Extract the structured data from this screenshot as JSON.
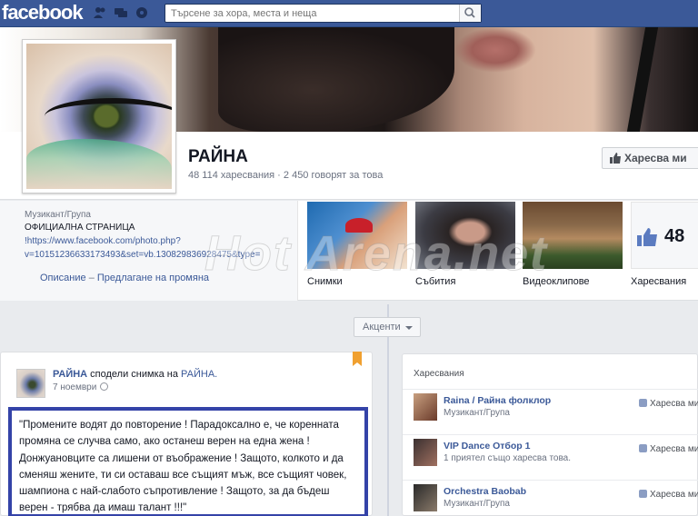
{
  "topbar": {
    "logo": "facebook",
    "search_placeholder": "Търсене за хора, места и неща",
    "icons": [
      "friend-requests-icon",
      "messages-icon",
      "notifications-icon",
      "search-icon"
    ]
  },
  "page": {
    "name": "РАЙНА",
    "stats": "48 114 харесвания · 2 450 говорят за това",
    "like_button": "Харесва ми"
  },
  "about": {
    "category": "Музикант/Група",
    "line1": "ОФИЦИАЛНА СТРАНИЦА",
    "line2": "!https://www.facebook.com/photo.php?",
    "line3": "v=10151236633173493&set=vb.130829836928475&type=",
    "link_description": "Описание",
    "link_suggest": "Предлагане на промяна"
  },
  "tiles": [
    {
      "label": "Снимки"
    },
    {
      "label": "Събития"
    },
    {
      "label": "Видеоклипове"
    },
    {
      "label": "Харесвания",
      "count": "48"
    }
  ],
  "timeline": {
    "accents_label": "Акценти"
  },
  "post": {
    "author": "РАЙНА",
    "action": " сподели снимка на ",
    "target": "РАЙНА.",
    "date": "7 ноември",
    "text": "\"Промените водят до повторение ! Парадоксално е, че коренната промяна се случва само, ако останеш верен на една жена ! Донжуановците са лишени от въображение ! Защото, колкото и да сменяш жените, ти си оставаш все същият мъж, все същият човек, шампиона с най-слабото съпротивление ! Защото, за да бъдеш верен - трябва да имаш талант !!!\""
  },
  "likes_box": {
    "title": "Харесвания",
    "items": [
      {
        "name": "Raina / Райна фолклор",
        "sub": "Музикант/Група",
        "action": "Харесва ми"
      },
      {
        "name": "VIP Dance Отбор 1",
        "sub": "1 приятел също харесва това.",
        "action": "Харесва ми"
      },
      {
        "name": "Orchestra Baobab",
        "sub": "Музикант/Група",
        "action": "Харесва ми"
      }
    ]
  },
  "watermark": "Hot Arena.net",
  "colors": {
    "brand": "#3b5998",
    "quote_border": "#3443a8",
    "bookmark": "#f0a030"
  }
}
